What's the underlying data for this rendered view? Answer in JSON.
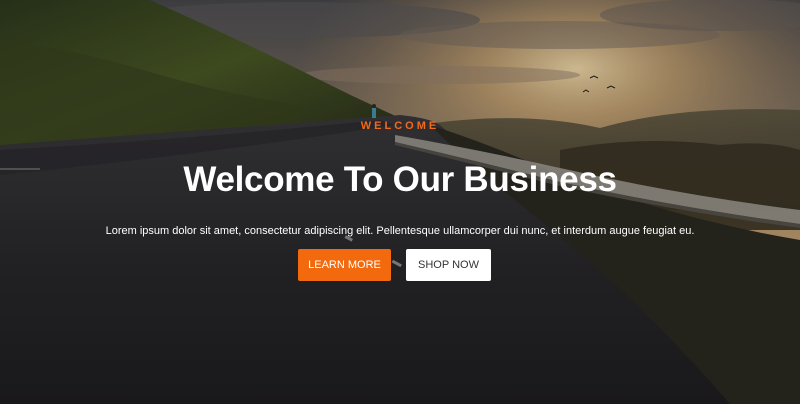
{
  "hero": {
    "eyebrow": "WELCOME",
    "headline": "Welcome To Our Business",
    "description": "Lorem ipsum dolor sit amet, consectetur adipiscing elit. Pellentesque ullamcorper dui nunc, et interdum augue feugiat eu.",
    "primary_button": "LEARN MORE",
    "secondary_button": "SHOP NOW"
  },
  "colors": {
    "accent": "#f26a0d",
    "text": "#ffffff",
    "button_secondary_bg": "#ffffff",
    "button_secondary_text": "#333333"
  },
  "background": {
    "scene": "mountain-road-sunset-photo"
  }
}
